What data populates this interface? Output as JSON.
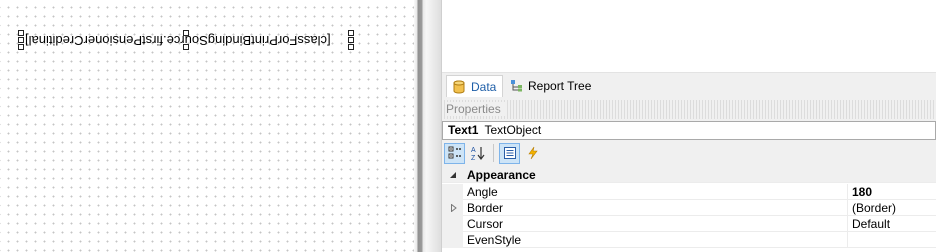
{
  "designer": {
    "text_object_content": "[classForPrintBindingSource.firstPensionerCreditinal]"
  },
  "tabs": [
    {
      "label": "Data",
      "icon": "database-icon",
      "active": true
    },
    {
      "label": "Report Tree",
      "icon": "report-tree-icon",
      "active": false
    }
  ],
  "properties": {
    "header": "Properties",
    "object_name": "Text1",
    "object_type": "TextObject",
    "toolbar": [
      {
        "icon": "categorized-icon",
        "active": true
      },
      {
        "icon": "sort-alphabetical-icon",
        "active": false
      },
      {
        "icon": "property-pages-icon",
        "active": true
      },
      {
        "icon": "events-lightning-icon",
        "active": false
      }
    ],
    "category": "Appearance",
    "rows": [
      {
        "name": "Angle",
        "value": "180",
        "bold": true,
        "expandable": false
      },
      {
        "name": "Border",
        "value": "(Border)",
        "bold": false,
        "expandable": true
      },
      {
        "name": "Cursor",
        "value": "Default",
        "bold": false,
        "expandable": false
      },
      {
        "name": "EvenStyle",
        "value": "",
        "bold": false,
        "expandable": false
      }
    ]
  },
  "colors": {
    "accent": "#1f5fa8",
    "selected_button": "#cde4f7"
  }
}
